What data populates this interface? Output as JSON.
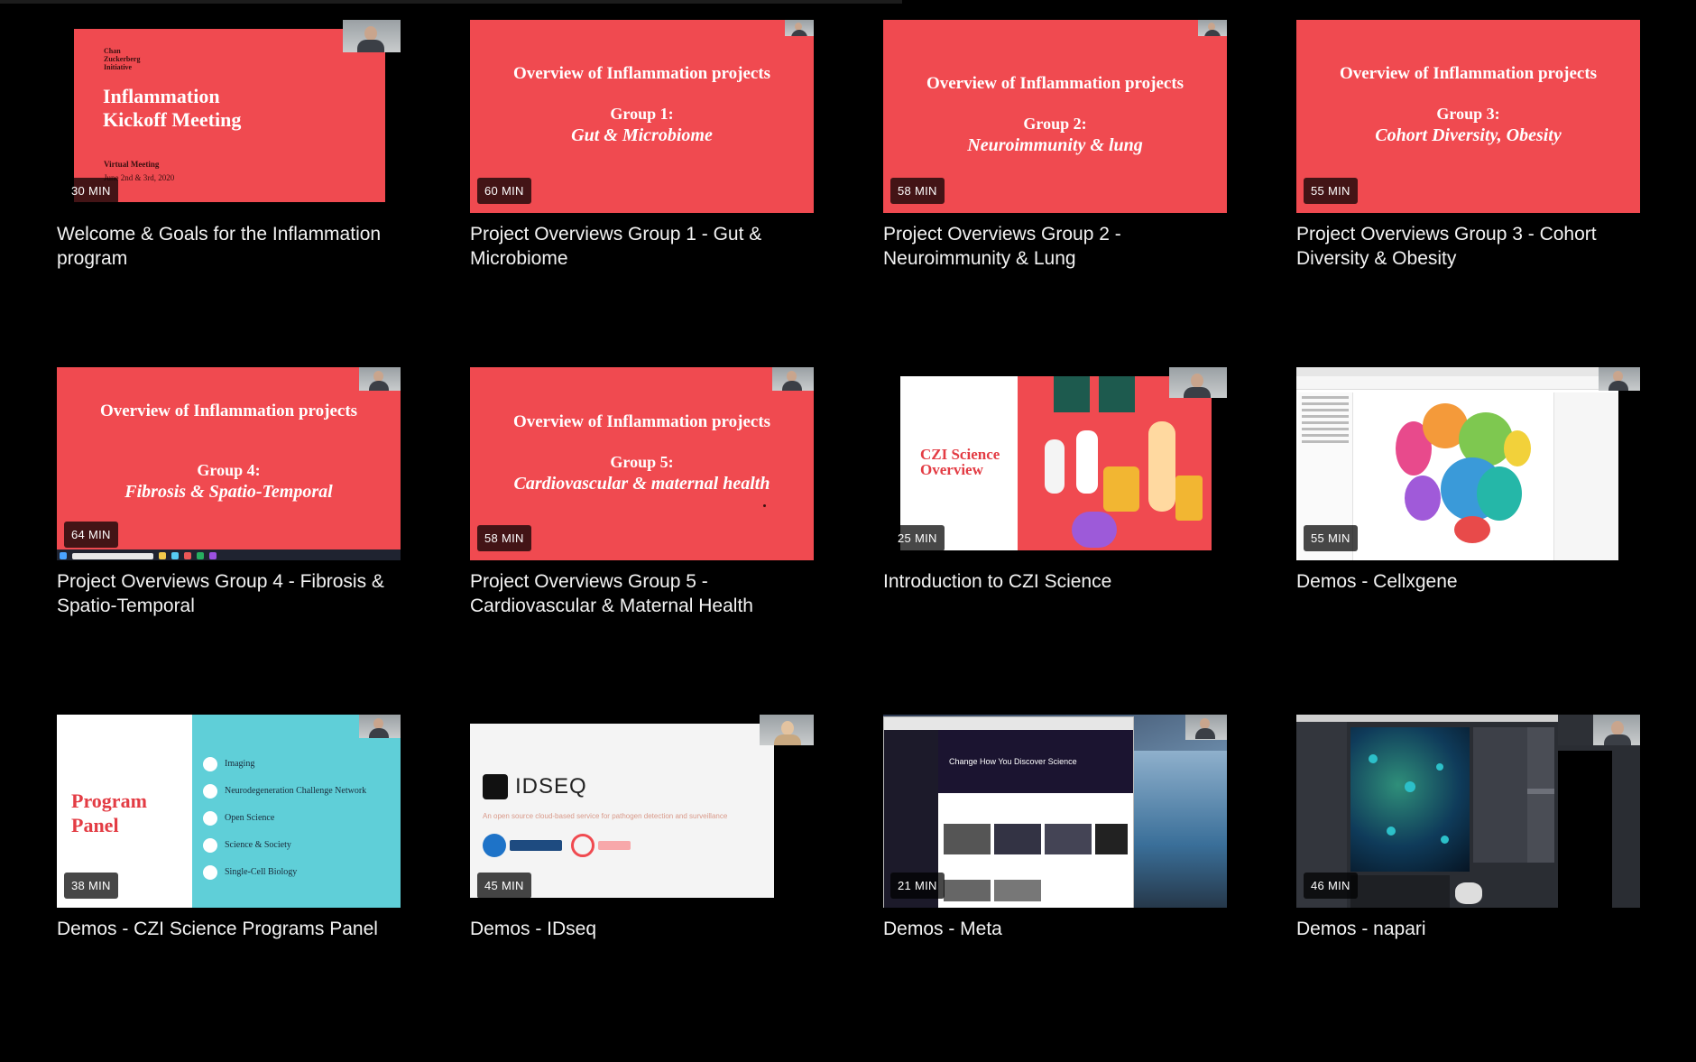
{
  "colors": {
    "background": "#000000",
    "slide_red": "#f04a50",
    "teal": "#5fcfd8"
  },
  "videos": [
    {
      "title": "Welcome & Goals for the Inflammation program",
      "duration": "30 MIN",
      "slide": {
        "org": [
          "Chan",
          "Zuckerberg",
          "Initiative"
        ],
        "headline": [
          "Inflammation",
          "Kickoff Meeting"
        ],
        "meeting": "Virtual Meeting",
        "dates": "June 2nd & 3rd, 2020"
      }
    },
    {
      "title": "Project Overviews Group 1 - Gut & Microbiome",
      "duration": "60 MIN",
      "slide": {
        "heading": "Overview of Inflammation projects",
        "group": "Group 1:",
        "topic": "Gut & Microbiome"
      }
    },
    {
      "title": "Project Overviews Group 2 - Neuroimmunity & Lung",
      "duration": "58 MIN",
      "slide": {
        "heading": "Overview of Inflammation projects",
        "group": "Group 2:",
        "topic": "Neuroimmunity & lung"
      }
    },
    {
      "title": "Project Overviews Group 3 - Cohort Diversity & Obesity",
      "duration": "55 MIN",
      "slide": {
        "heading": "Overview of Inflammation projects",
        "group": "Group 3:",
        "topic": "Cohort Diversity, Obesity"
      }
    },
    {
      "title": "Project Overviews Group 4 - Fibrosis & Spatio-Temporal",
      "duration": "64 MIN",
      "slide": {
        "heading": "Overview of Inflammation projects",
        "group": "Group 4:",
        "topic": "Fibrosis & Spatio-Temporal"
      }
    },
    {
      "title": "Project Overviews Group 5 - Cardiovascular & Maternal Health",
      "duration": "58 MIN",
      "slide": {
        "heading": "Overview of Inflammation projects",
        "group": "Group 5:",
        "topic": "Cardiovascular & maternal health"
      }
    },
    {
      "title": "Introduction to CZI Science",
      "duration": "25 MIN",
      "slide": {
        "headline": [
          "CZI Science",
          "Overview"
        ]
      }
    },
    {
      "title": "Demos - Cellxgene",
      "duration": "55 MIN"
    },
    {
      "title": "Demos - CZI Science Programs Panel",
      "duration": "38 MIN",
      "slide": {
        "headline": [
          "Program",
          "Panel"
        ],
        "items": [
          "Imaging",
          "Neurodegeneration Challenge Network",
          "Open Science",
          "Science & Society",
          "Single-Cell Biology"
        ]
      }
    },
    {
      "title": "Demos - IDseq",
      "duration": "45 MIN",
      "slide": {
        "logo": "IDSEQ",
        "tagline": "An open source cloud-based service for pathogen detection and surveillance"
      }
    },
    {
      "title": "Demos - Meta",
      "duration": "21 MIN",
      "slide": {
        "headline": "Change How You Discover Science"
      }
    },
    {
      "title": "Demos - napari",
      "duration": "46 MIN"
    }
  ]
}
